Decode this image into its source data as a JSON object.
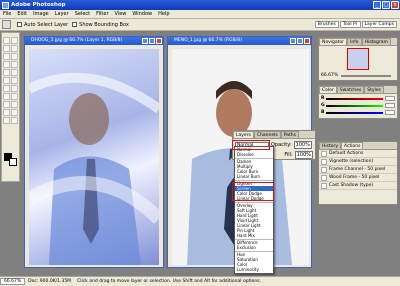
{
  "window": {
    "title": "Adobe Photoshop"
  },
  "menu": [
    "File",
    "Edit",
    "Image",
    "Layer",
    "Select",
    "Filter",
    "View",
    "Window",
    "Help"
  ],
  "options": {
    "auto_select": "Auto Select Layer",
    "bounding": "Show Bounding Box"
  },
  "well_tabs": [
    "Brushes",
    "Tool Pr",
    "Layer Comps"
  ],
  "doc1": {
    "title": "DHOOG_1.jpg @ 66.7% (Layer 1, RGB/8)"
  },
  "doc2": {
    "title": "MENO_1.jpg @ 66.7% (RGB/8)"
  },
  "navigator": {
    "tabs": [
      "Navigator",
      "Info",
      "Histogram"
    ],
    "zoom": "66.67%"
  },
  "color": {
    "tabs": [
      "Color",
      "Swatches",
      "Styles"
    ],
    "r": "R",
    "g": "G",
    "b": "B"
  },
  "history": {
    "tabs": [
      "History",
      "Actions"
    ],
    "items": [
      "Default Actions",
      "Vignette (selection)",
      "Frame Channel - 50 pixel",
      "Wood Frame - 50 pixel",
      "Cast Shadow (type)"
    ]
  },
  "layers": {
    "tabs": [
      "Layers",
      "Channels",
      "Paths"
    ],
    "mode": "Normal",
    "opacity_label": "Opacity:",
    "opacity": "100%",
    "fill_label": "Fill:",
    "fill": "100%"
  },
  "blend_modes": [
    "Normal",
    "Dissolve",
    "",
    "Darken",
    "Multiply",
    "Color Burn",
    "Linear Burn",
    "",
    "Lighten",
    "Screen",
    "Color Dodge",
    "Linear Dodge",
    "",
    "Overlay",
    "Soft Light",
    "Hard Light",
    "Vivid Light",
    "Linear Light",
    "Pin Light",
    "Hard Mix",
    "",
    "Difference",
    "Exclusion",
    "",
    "Hue",
    "Saturation",
    "Color",
    "Luminosity"
  ],
  "status": {
    "zoom": "66.67%",
    "doc": "Doc: 900.0K/1.35M",
    "hint": "Click and drag to move layer or selection.  Use Shift and Alt for additional options."
  },
  "colors": {
    "accent": "#e01010",
    "titlebar": "#0a3cb8"
  }
}
